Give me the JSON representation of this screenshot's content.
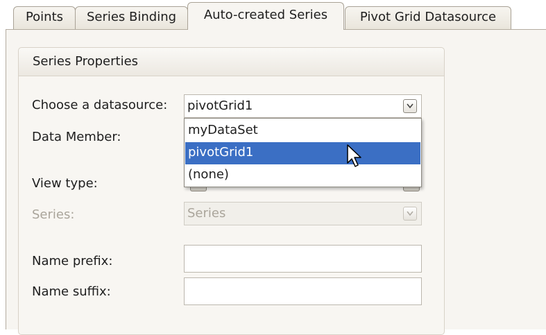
{
  "tabs": [
    {
      "label": "Points"
    },
    {
      "label": "Series Binding"
    },
    {
      "label": "Auto-created Series"
    },
    {
      "label": "Pivot Grid Datasource"
    }
  ],
  "group": {
    "title": "Series Properties"
  },
  "fields": {
    "datasource": {
      "label": "Choose a datasource:",
      "value": "pivotGrid1"
    },
    "data_member": {
      "label": "Data Member:"
    },
    "view_type": {
      "label": "View type:"
    },
    "series": {
      "label": "Series:",
      "value": "Series"
    },
    "name_prefix": {
      "label": "Name prefix:",
      "value": ""
    },
    "name_suffix": {
      "label": "Name suffix:",
      "value": ""
    }
  },
  "dropdown": {
    "options": [
      "myDataSet",
      "pivotGrid1",
      "(none)"
    ],
    "selected": "pivotGrid1"
  },
  "colors": {
    "selection": "#3b6fc4",
    "panel": "#f7f5f1"
  }
}
